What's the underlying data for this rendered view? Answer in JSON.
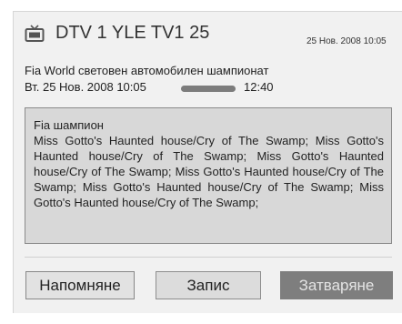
{
  "header": {
    "icon": "tv-icon",
    "channel": "DTV  1 YLE TV1 25",
    "datetime": "25 Нов. 2008 10:05"
  },
  "program": {
    "title": "Fia World световен автомобилен шампионат",
    "start": "Вт. 25 Нов. 2008 10:05",
    "end": "12:40",
    "progress_fraction": 1.0
  },
  "description": {
    "title": "Fia шампион",
    "text": "Miss Gotto's Haunted house/Cry of The Swamp; Miss Gotto's Haunted house/Cry of The Swamp; Miss Gotto's Haunted house/Cry of The Swamp; Miss Gotto's Haunted house/Cry of The Swamp; Miss Gotto's Haunted house/Cry of The Swamp; Miss Gotto's Haunted house/Cry of The Swamp;"
  },
  "buttons": {
    "remind": "Напомняне",
    "record": "Запис",
    "close": "Затваряне"
  },
  "colors": {
    "panel_bg": "#f1f1f1",
    "desc_bg": "#d8d8d8",
    "close_bg": "#7e7e7e"
  }
}
